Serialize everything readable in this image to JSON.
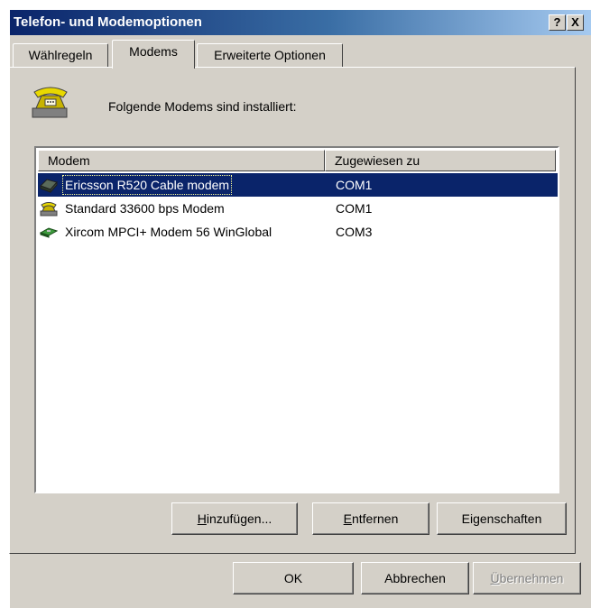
{
  "window": {
    "title": "Telefon- und Modemoptionen",
    "help_label": "?",
    "close_label": "X",
    "titlebar_colors": [
      "#0a246a",
      "#a6caf0"
    ]
  },
  "tabs": [
    {
      "label": "Wählregeln",
      "active": false
    },
    {
      "label": "Modems",
      "active": true
    },
    {
      "label": "Erweiterte Optionen",
      "active": false
    }
  ],
  "intro_text": "Folgende Modems sind installiert:",
  "intro_icon": "telephone-icon",
  "modem_list": {
    "columns": [
      "Modem",
      "Zugewiesen zu"
    ],
    "rows": [
      {
        "name": "Ericsson R520 Cable modem",
        "port": "COM1",
        "icon": "cable-modem-icon",
        "selected": true
      },
      {
        "name": "Standard 33600 bps Modem",
        "port": "COM1",
        "icon": "telephone-modem-icon",
        "selected": false
      },
      {
        "name": "Xircom MPCI+ Modem 56 WinGlobal",
        "port": "COM3",
        "icon": "pci-card-modem-icon",
        "selected": false
      }
    ],
    "selection_color": "#0a246a"
  },
  "list_buttons": {
    "add": {
      "accel": "H",
      "rest": "inzufügen..."
    },
    "remove": {
      "accel": "E",
      "rest": "ntfernen"
    },
    "properties": {
      "pre": "Ei",
      "accel": "g",
      "rest": "enschaften"
    }
  },
  "dialog_buttons": {
    "ok": "OK",
    "cancel": "Abbrechen",
    "apply": {
      "accel": "Ü",
      "rest": "bernehmen",
      "disabled": true
    }
  }
}
